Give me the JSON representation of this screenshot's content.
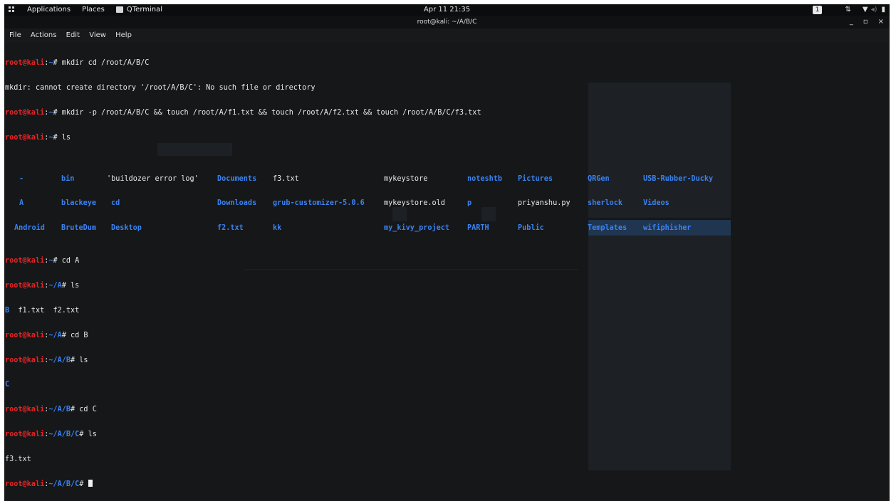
{
  "top_panel": {
    "apps_label": "Applications",
    "places_label": "Places",
    "app_name": "QTerminal",
    "clock": "Apr 11 21:35",
    "workspace": "1"
  },
  "title_bar": {
    "title": "root@kali: ~/A/B/C",
    "minimize": "_",
    "maximize": "▫",
    "close": "×"
  },
  "menu": [
    "File",
    "Actions",
    "Edit",
    "View",
    "Help"
  ],
  "prompt": {
    "user_host": "root@kali",
    "colon": ":"
  },
  "lines": [
    {
      "path": "~",
      "cmd": "mkdir cd /root/A/B/C"
    },
    {
      "output": "mkdir: cannot create directory '/root/A/B/C': No such file or directory"
    },
    {
      "path": "~",
      "cmd": "mkdir -p /root/A/B/C && touch /root/A/f1.txt && touch /root/A/f2.txt && touch /root/A/B/C/f3.txt"
    },
    {
      "path": "~",
      "cmd": "ls"
    }
  ],
  "ls_root": [
    [
      "-",
      "bin",
      "'buildozer error log'",
      "Documents",
      "f3.txt",
      "mykeystore",
      "noteshtb",
      "Pictures",
      "QRGen",
      "USB-Rubber-Ducky"
    ],
    [
      "A",
      "blackeye",
      "cd",
      "Downloads",
      "grub-customizer-5.0.6",
      "mykeystore.old",
      "p",
      "priyanshu.py",
      "sherlock",
      "Videos"
    ],
    [
      "Android",
      "BruteDum",
      "Desktop",
      "f2.txt",
      "kk",
      "my_kivy_project",
      "PARTH",
      "Public",
      "Templates",
      "wifiphisher"
    ]
  ],
  "session": [
    {
      "path": "~",
      "cmd": "cd A"
    },
    {
      "path": "~/A",
      "cmd": "ls"
    },
    {
      "output_parts": [
        "B",
        "  f1.txt  f2.txt"
      ]
    },
    {
      "path": "~/A",
      "cmd": "cd B"
    },
    {
      "path": "~/A/B",
      "cmd": "ls"
    },
    {
      "output": "C"
    },
    {
      "path": "~/A/B",
      "cmd": "cd C"
    },
    {
      "path": "~/A/B/C",
      "cmd": "ls"
    },
    {
      "output": "f3.txt"
    },
    {
      "path": "~/A/B/C",
      "cmd": ""
    }
  ],
  "colors": {
    "prompt_user": "#e82424",
    "prompt_path": "#3b82f0",
    "background": "#151719"
  }
}
